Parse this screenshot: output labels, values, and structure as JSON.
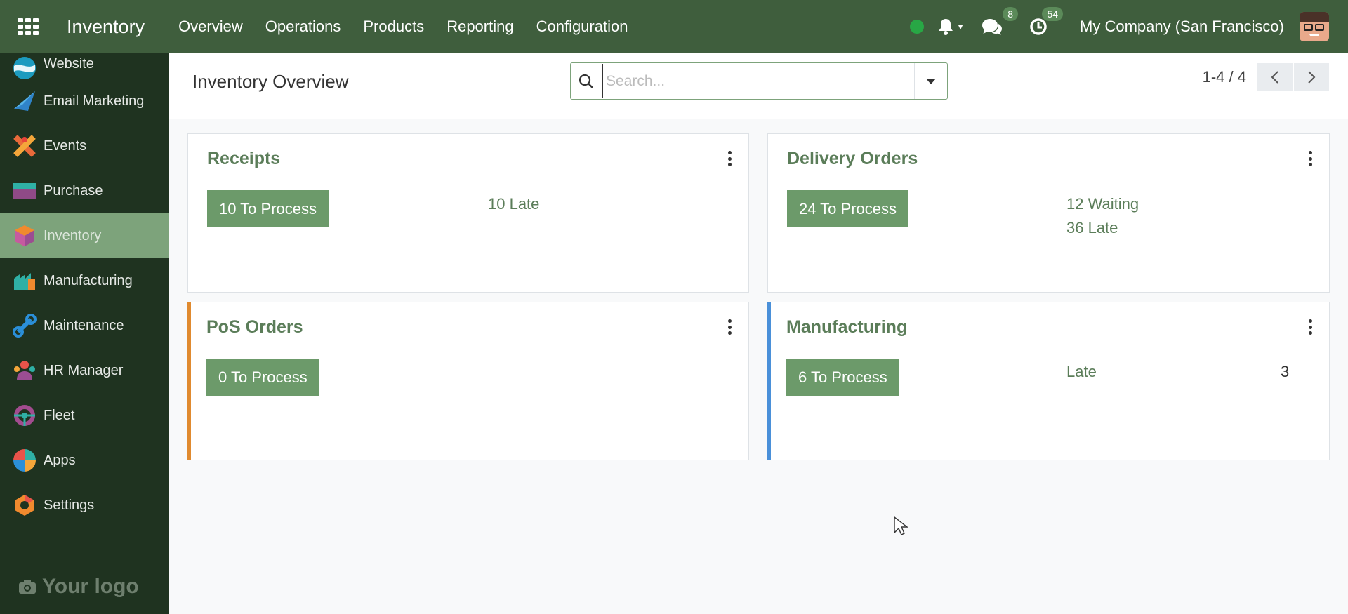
{
  "navbar": {
    "app_title": "Inventory",
    "menu": [
      "Overview",
      "Operations",
      "Products",
      "Reporting",
      "Configuration"
    ],
    "messages_count": "8",
    "activities_count": "54",
    "company": "My Company (San Francisco)",
    "status_color": "#28a745"
  },
  "sidebar": {
    "items": [
      {
        "label": "Website",
        "icon": "website-icon"
      },
      {
        "label": "Email Marketing",
        "icon": "email-marketing-icon"
      },
      {
        "label": "Events",
        "icon": "events-icon"
      },
      {
        "label": "Purchase",
        "icon": "purchase-icon"
      },
      {
        "label": "Inventory",
        "icon": "inventory-icon",
        "active": true
      },
      {
        "label": "Manufacturing",
        "icon": "manufacturing-icon"
      },
      {
        "label": "Maintenance",
        "icon": "maintenance-icon"
      },
      {
        "label": "HR Manager",
        "icon": "hr-manager-icon"
      },
      {
        "label": "Fleet",
        "icon": "fleet-icon"
      },
      {
        "label": "Apps",
        "icon": "apps-icon"
      },
      {
        "label": "Settings",
        "icon": "settings-icon"
      }
    ],
    "logo_text": "Your logo"
  },
  "control": {
    "title": "Inventory Overview",
    "search_placeholder": "Search...",
    "pager": "1-4 / 4"
  },
  "cards": {
    "receipts": {
      "title": "Receipts",
      "button": "10 To Process",
      "late": "10 Late"
    },
    "delivery": {
      "title": "Delivery Orders",
      "button": "24 To Process",
      "waiting": "12 Waiting",
      "late": "36 Late"
    },
    "pos": {
      "title": "PoS Orders",
      "button": "0 To Process",
      "accent": "#e08a2f"
    },
    "manufacturing": {
      "title": "Manufacturing",
      "button": "6 To Process",
      "late_label": "Late",
      "late_count": "3",
      "accent": "#4a90d9"
    }
  },
  "colors": {
    "navbar": "#3f5e3d",
    "sidebar": "#1f3320",
    "primary": "#6c9a6a",
    "active_item": "#7da37b"
  }
}
